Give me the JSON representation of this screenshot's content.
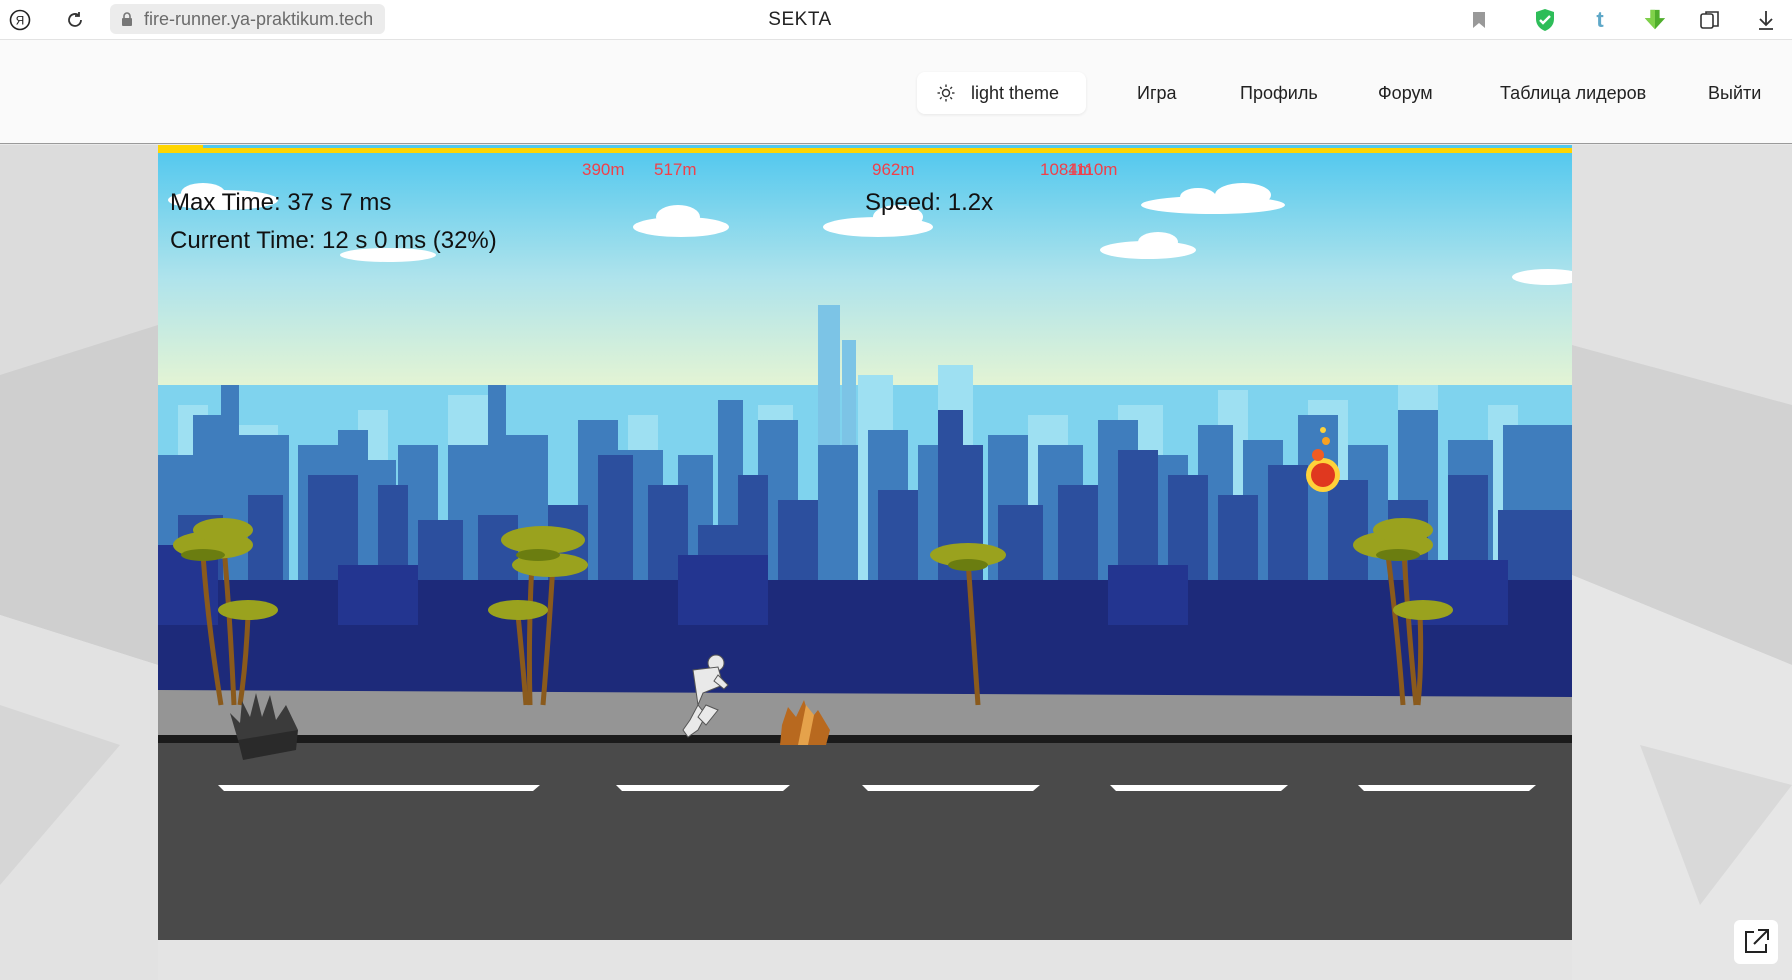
{
  "browser": {
    "url": "fire-runner.ya-praktikum.tech",
    "tab_title": "SEKTA"
  },
  "header": {
    "theme_button": "light theme",
    "nav": [
      "Игра",
      "Профиль",
      "Форум",
      "Таблица лидеров",
      "Выйти"
    ]
  },
  "game": {
    "max_time": "Max Time: 37 s 7 ms",
    "current_time": "Current Time: 12 s 0 ms (32%)",
    "speed": "Speed: 1.2x",
    "distance_markers": [
      "390m",
      "517m",
      "962m",
      "1084m",
      "1110m"
    ],
    "progress_fraction": 0.032
  },
  "icons": {
    "browser_logo": "yandex-logo-icon",
    "reload": "reload-icon",
    "lock": "lock-icon",
    "bookmark": "bookmark-icon",
    "shield": "shield-icon",
    "tumblr": "tumblr-icon",
    "download_ext": "download-extension-icon",
    "collections": "collections-icon",
    "downloads": "download-icon",
    "theme": "sun-icon",
    "popout": "popout-icon"
  },
  "colors": {
    "marker": "#f0404a",
    "progress": "#ffd500",
    "sky_top": "#4fc7ee",
    "road": "#4a4a4a"
  }
}
